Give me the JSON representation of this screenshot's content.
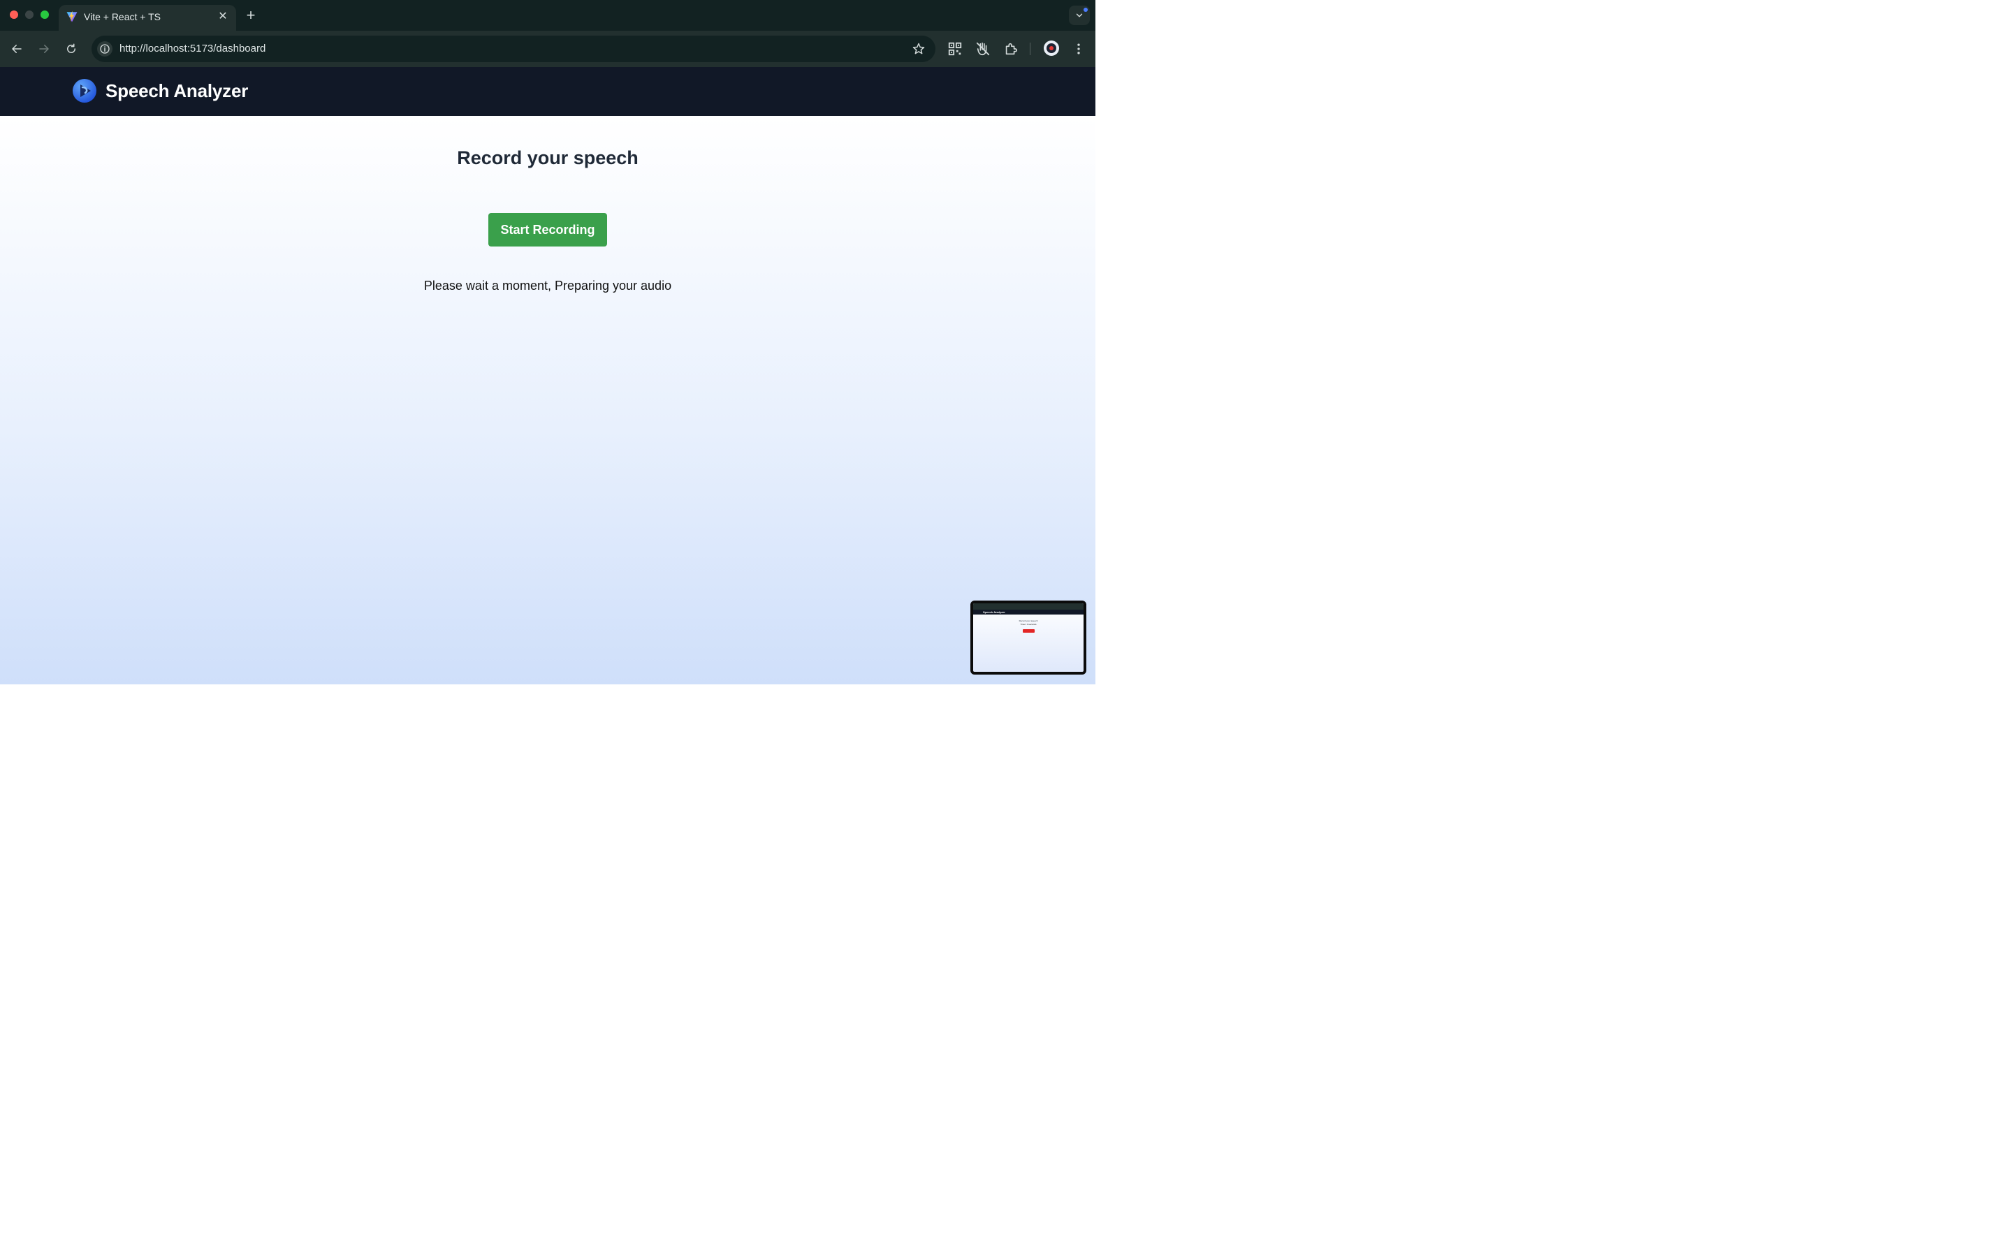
{
  "browser": {
    "tab_title": "Vite + React + TS",
    "url": "http://localhost:5173/dashboard",
    "icons": {
      "back": "arrow-left-icon",
      "forward": "arrow-right-icon",
      "reload": "reload-icon",
      "site_info": "info-icon",
      "bookmark": "star-icon",
      "qr": "qr-code-icon",
      "extension_blocked": "blocked-extension-icon",
      "extensions": "puzzle-icon",
      "menu": "kebab-menu-icon"
    }
  },
  "header": {
    "brand": "Speech Analyzer"
  },
  "main": {
    "title": "Record your speech",
    "record_button": "Start Recording",
    "status": "Please wait a moment, Preparing your audio"
  },
  "thumbnail": {
    "brand": "Speech Analyzer",
    "title": "Record your speech",
    "subtitle": "Timer: 0 seconds"
  },
  "colors": {
    "header_bg": "#111827",
    "record_button": "#3aa04b",
    "title_text": "#1f2937",
    "logo_blue": "#2563eb"
  }
}
